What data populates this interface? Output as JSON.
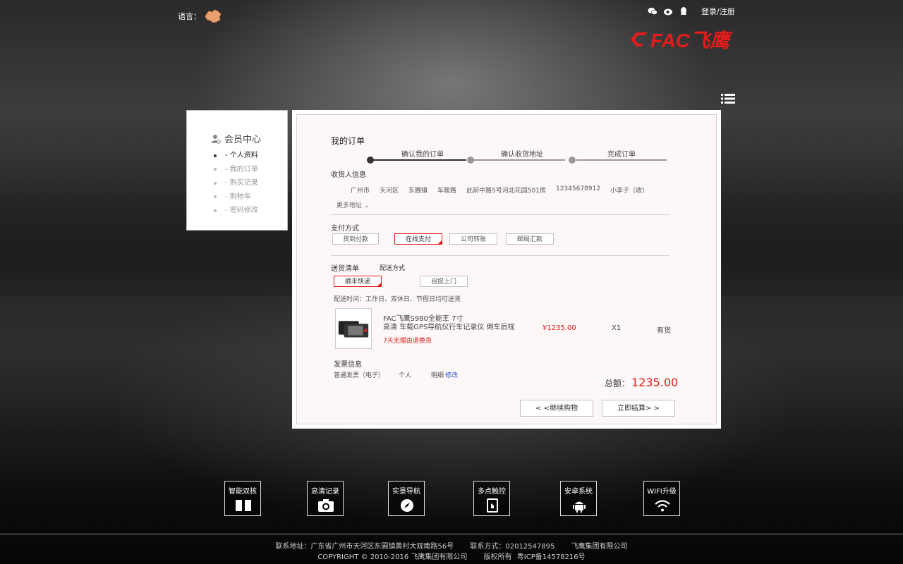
{
  "header": {
    "language_label": "语言：",
    "login_label": "登录/注册",
    "logo_text": "FAC飞鹰"
  },
  "colors": {
    "accent": "#e21b1b",
    "link": "#2a55c0"
  },
  "sidebar": {
    "title": "会员中心",
    "items": [
      {
        "label": "- 个人资料"
      },
      {
        "label": "- 我的订单"
      },
      {
        "label": "- 购买记录"
      },
      {
        "label": "- 购物车"
      },
      {
        "label": "- 密码修改"
      }
    ]
  },
  "order": {
    "title": "我的订单",
    "steps": [
      "确认我的订单",
      "确认收货地址",
      "完成订单"
    ],
    "receiver": {
      "label": "收货人信息",
      "fields": [
        "广州市",
        "天河区",
        "东圃镇",
        "车陂路",
        "此前中路5号河北花园501房",
        "12345678912",
        "小李子（收）"
      ],
      "more_label": "更多地址"
    },
    "payment": {
      "label": "支付方式",
      "options": [
        "货到付款",
        "在线支付",
        "公司转账",
        "邮局汇款"
      ],
      "selected": "在线支付"
    },
    "delivery": {
      "label": "送货清单",
      "method_label": "配送方式",
      "options": [
        "顺丰快递",
        "自提上门"
      ],
      "selected": "顺丰快递",
      "time_note": "配送时间：工作日、双休日、节假日均可送货"
    },
    "product": {
      "name_line1": "FAC飞鹰S980全能王 7寸",
      "name_line2": "高清 车载GPS导航仪行车记录仪 倒车后视",
      "promo": "7天无理由退换货",
      "price": "¥1235.00",
      "qty": "X1",
      "stock": "有货"
    },
    "invoice": {
      "label": "发票信息",
      "type": "普通发票（电子）",
      "title": "个人",
      "content": "明细",
      "edit_label": "修改"
    },
    "total_label": "总额：",
    "total_value": "1235.00",
    "continue_label": "< <继续购物",
    "checkout_label": "立即结算> >"
  },
  "features": [
    "智能双核",
    "高清记录",
    "实景导航",
    "多点触控",
    "安卓系统",
    "WIFI升级"
  ],
  "footer": {
    "address": "联系地址：广东省广州市天河区东圃镇黄村大观南路56号",
    "contact": "联系方式：02012547895",
    "company": "飞鹰集团有限公司",
    "copyright": "COPYRIGHT © 2010-2016 飞鹰集团有限公司",
    "rights": "版权所有",
    "icp": "粤ICP备14578216号"
  }
}
